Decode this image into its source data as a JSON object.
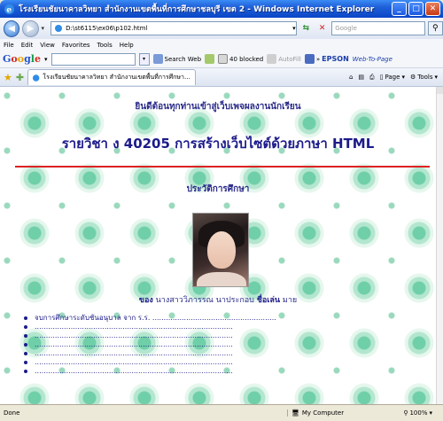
{
  "window": {
    "title": "โรงเรียนชัยนาคาลวิทยา สำนักงานเขตพื้นที่การศึกษาชลบุรี เขต 2 - Windows Internet Explorer",
    "buttons": {
      "minimize": "_",
      "maximize": "□",
      "close": "✕"
    }
  },
  "address_bar": {
    "url": "D:\\st6115\\ex06\\p102.html",
    "search_placeholder": "Google"
  },
  "menu": [
    "File",
    "Edit",
    "View",
    "Favorites",
    "Tools",
    "Help"
  ],
  "google_toolbar": {
    "logo_letters": [
      "G",
      "o",
      "o",
      "g",
      "l",
      "e"
    ],
    "search_web": "Search Web",
    "blocked": "40 blocked",
    "autofill": "AutoFill",
    "epson": "EPSON",
    "web_to_page": "Web-To-Page"
  },
  "tab_row": {
    "tab_title": "โรงเรียนชัยนาคาลวิทยา สำนักงานเขตพื้นที่การศึกษาชลบุ...",
    "page_label": "Page",
    "tools_label": "Tools"
  },
  "page": {
    "welcome": "ยินดีต้อนทุกท่านเข้าสู่เว็บเพจผลงานนักเรียน",
    "course": "รายวิชา ง 40205 การสร้างเว็บไซต์ด้วยภาษา HTML",
    "history_heading": "ประวัติการศึกษา",
    "owner_prefix": "ของ",
    "owner_name": "นางสาววิภารรณ นาประกอบ",
    "nickname_label": "ชื่อเล่น",
    "nickname": "มาย",
    "list_items": [
      "จบการศึกษาระดับชั้นอนุบาล จาก ร.ร. .......................................................",
      "........................................................................................",
      "........................................................................................",
      "........................................................................................",
      "........................................................................................",
      "........................................................................................",
      "........................................................................................"
    ]
  },
  "status_bar": {
    "status": "Done",
    "zone": "My Computer",
    "zoom": "100%"
  },
  "colors": {
    "heading_blue": "#1c1b8a",
    "divider_red": "#dd2222",
    "bubble_green": "#6fcfa8"
  }
}
